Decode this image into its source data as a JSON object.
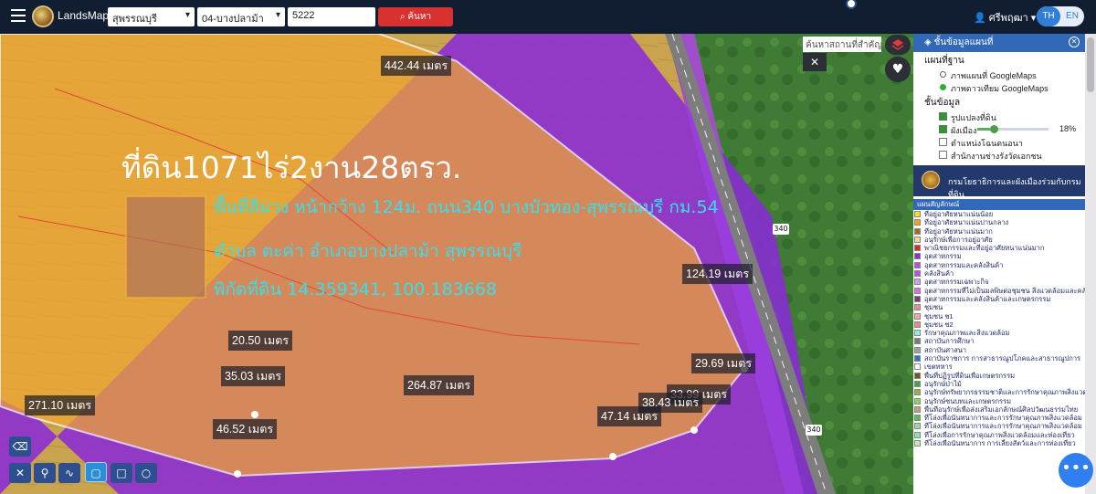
{
  "app": {
    "title": "LandsMaps"
  },
  "search": {
    "province": "สุพรรณบุรี",
    "district": "04-บางปลาม้า",
    "parcel_no": "5222",
    "button_label": "ค้นหา"
  },
  "user": {
    "name": "ศรีพฤฒา",
    "lang_th": "TH",
    "lang_en": "EN"
  },
  "map": {
    "place_search_placeholder": "ค้นหาสถานที่สำคัญ",
    "close_label": "✕",
    "title_text": "ที่ดิน1071ไร่2งาน28ตรว.",
    "info_lines": [
      "พื้นที่สีม่วง หน้ากว้าง 124ม. ถนน340 บางบัวทอง-สุพรรณบุรี กม.54",
      "ตำบล ตะค่า อำเภอบางปลาม้า สุพรรณบุรี",
      "พิกัดที่ดิน 14.359341, 100.183668"
    ],
    "distances": [
      "442.44 เมตร",
      "124.19 เมตร",
      "20.50 เมตร",
      "35.03 เมตร",
      "264.87 เมตร",
      "29.69 เมตร",
      "33.99 เมตร",
      "38.43 เมตร",
      "47.14 เมตร",
      "271.10 เมตร",
      "46.52 เมตร"
    ],
    "road_badges": [
      "340",
      "340"
    ]
  },
  "panel": {
    "title": "ชั้นข้อมูลแผนที่",
    "basemap_title": "แผนที่ฐาน",
    "basemaps": [
      {
        "label": "ภาพแผนที่ GoogleMaps",
        "selected": false
      },
      {
        "label": "ภาพดาวเทียม GoogleMaps",
        "selected": true
      }
    ],
    "layers_title": "ชั้นข้อมูล",
    "layers": [
      {
        "label": "รูปแปลงที่ดิน",
        "checked": true
      },
      {
        "label": "ผังเมือง",
        "checked": true,
        "opacity_pct": "18%",
        "opacity": 0.18
      },
      {
        "label": "ตำแหน่งโฉนดนอนา",
        "checked": false
      },
      {
        "label": "สำนักงานช่างรังวัดเอกชน",
        "checked": false
      }
    ],
    "department": "กรมโยธาธิการและผังเมืองร่วมกับกรมที่ดิน",
    "legend_title": "แผนสัญลักษณ์",
    "legend": [
      {
        "label": "ที่อยู่อาศัยหนาแน่นน้อย",
        "color": "#f6e020"
      },
      {
        "label": "ที่อยู่อาศัยหนาแน่นปานกลาง",
        "color": "#f2a21d"
      },
      {
        "label": "ที่อยู่อาศัยหนาแน่นมาก",
        "color": "#a1692e"
      },
      {
        "label": "อนุรักษ์เพื่อการอยู่อาศัย",
        "color": "#f2d98e"
      },
      {
        "label": "พาณิชยกรรมและที่อยู่อาศัยหนาแน่นมาก",
        "color": "#e0282c"
      },
      {
        "label": "อุตสาหกรรม",
        "color": "#8b2fd1"
      },
      {
        "label": "อุตสาหกรรมและคลังสินค้า",
        "color": "#b553d6"
      },
      {
        "label": "คลังสินค้า",
        "color": "#b84fe0"
      },
      {
        "label": "อุตสาหกรรมเฉพาะกิจ",
        "color": "#c9a2e8"
      },
      {
        "label": "อุตสาหกรรมที่ไม่เป็นมลพิษต่อชุมชน สิ่งแวดล้อมและคลังสินค้า",
        "color": "#d86ee8"
      },
      {
        "label": "อุตสาหกรรมและคลังสินค้าและเกษตรกรรม",
        "color": "#7a3e74"
      },
      {
        "label": "ชุมชน",
        "color": "#e68f91"
      },
      {
        "label": "ชุมชน ช1",
        "color": "#f1a9a5"
      },
      {
        "label": "ชุมชน ช2",
        "color": "#e98780"
      },
      {
        "label": "รักษาคุณภาพและสิ่งแวดล้อม",
        "color": "#8ef0d9"
      },
      {
        "label": "สถาบันการศึกษา",
        "color": "#7a7a7a"
      },
      {
        "label": "สถาบันศาสนา",
        "color": "#9aa09a"
      },
      {
        "label": "สถาบันราชการ การสาธารณูปโภคและสาธารณูปการ",
        "color": "#2a78c8"
      },
      {
        "label": "เขตทหาร",
        "color": "#ffffff"
      },
      {
        "label": "พื้นที่ปฏิรูปที่ดินเพื่อเกษตรกรรม",
        "color": "#6e5a1e"
      },
      {
        "label": "อนุรักษ์ป่าไม้",
        "color": "#3ea646"
      },
      {
        "label": "อนุรักษ์ทรัพยากรธรรมชาติและการรักษาคุณภาพสิ่งแวดล้อม",
        "color": "#8fb04a"
      },
      {
        "label": "อนุรักษ์ชนบทและเกษตรกรรม",
        "color": "#8fd35a"
      },
      {
        "label": "พื้นที่อนุรักษ์เพื่อส่งเสริมเอกลักษณ์ศิลปวัฒนธรรมไทย",
        "color": "#b8a47a"
      },
      {
        "label": "ที่โล่งเพื่อนันทนาการและการรักษาคุณภาพสิ่งแวดล้อม",
        "color": "#54c24a"
      },
      {
        "label": "ที่โล่งเพื่อนันทนาการและการรักษาคุณภาพสิ่งแวดล้อม",
        "color": "#a0d6a0"
      },
      {
        "label": "ที่โล่งเพื่อการรักษาคุณภาพสิ่งแวดล้อมและท่องเที่ยว",
        "color": "#8ee0b4"
      },
      {
        "label": "ที่โล่งเพื่อนันทนาการ การเลี้ยงสัตว์และการท่องเที่ยว",
        "color": "#c4e8b0"
      }
    ]
  },
  "tools": [
    "eraser-tool",
    "line-tool",
    "marker-tool",
    "path-tool",
    "select-tool",
    "rectangle-tool",
    "circle-tool"
  ],
  "fab_label": "•••"
}
